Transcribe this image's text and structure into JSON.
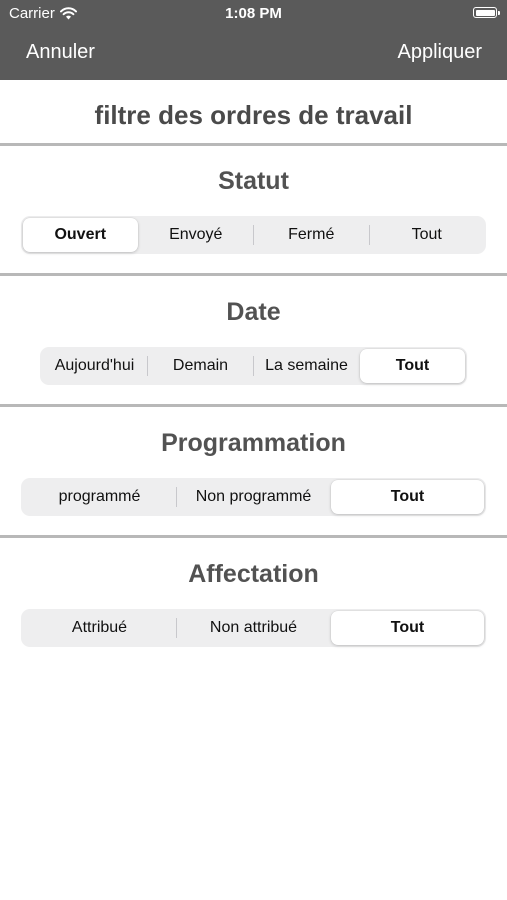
{
  "status_bar": {
    "carrier": "Carrier",
    "time": "1:08 PM"
  },
  "nav": {
    "cancel_label": "Annuler",
    "apply_label": "Appliquer"
  },
  "page_title": "filtre des ordres de travail",
  "sections": {
    "statut": {
      "title": "Statut",
      "options": [
        "Ouvert",
        "Envoyé",
        "Fermé",
        "Tout"
      ],
      "selected": "Ouvert"
    },
    "date": {
      "title": "Date",
      "options": [
        "Aujourd'hui",
        "Demain",
        "La semaine",
        "Tout"
      ],
      "selected": "Tout"
    },
    "programmation": {
      "title": "Programmation",
      "options": [
        "programmé",
        "Non programmé",
        "Tout"
      ],
      "selected": "Tout"
    },
    "affectation": {
      "title": "Affectation",
      "options": [
        "Attribué",
        "Non attribué",
        "Tout"
      ],
      "selected": "Tout"
    }
  },
  "colors": {
    "nav_background": "#5a5a5a",
    "divider": "#b8b8b8",
    "segment_track": "#eeeeef",
    "segment_selected": "#ffffff"
  }
}
